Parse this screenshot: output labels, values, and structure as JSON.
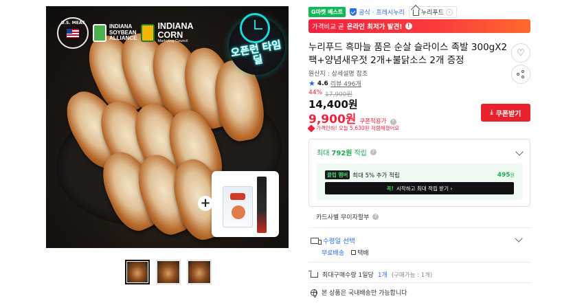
{
  "gallery": {
    "logos": {
      "usmef_seal": "U.S. MEAT",
      "soybean_line1": "INDIANA",
      "soybean_line2": "SOYBEAN",
      "soybean_line3": "ALLIANCE",
      "corn_line1": "INDIANA",
      "corn_line2": "CORN",
      "corn_sub": "Marketing Council"
    },
    "timedeal_badge": "오픈런 타임딜",
    "thumbnails": [
      {
        "name": "thumbnail-1",
        "active": true
      },
      {
        "name": "thumbnail-2",
        "active": false
      },
      {
        "name": "thumbnail-3",
        "active": false
      }
    ]
  },
  "tags": {
    "best": "G마켓 베스트",
    "official_label": "공식",
    "official_tier": "· 프레시누리",
    "store_name": "누리푸드"
  },
  "banner": {
    "prefix": "가격비교 곧",
    "bold": "온라인 최저가 발견!",
    "info_icon": "!"
  },
  "product": {
    "title": "누리푸드 흑마늘 품은 순살 슬라이스 족발 300gX2팩+양념새우젓 2개+불닭소스 2개 증정",
    "origin": "원산지 : 상세설명 참조",
    "rating_score": "4.6",
    "review_label": "리뷰 496개",
    "discount_pct": "44%",
    "original_price": "17,900원",
    "price": "14,400원",
    "coupon_price": "9,900원",
    "coupon_price_label": "쿠폰적용가",
    "price_notice": "가격인하! 오늘 5,630원 저렴해졌어요"
  },
  "actions": {
    "coupon_button": "쿠폰받기"
  },
  "points": {
    "head_prefix": "최대",
    "head_amount": "792원",
    "head_suffix": "적립",
    "club_badge": "클럽",
    "club_badge_rest": "멤버",
    "club_text": "최대 5% 추가 적립",
    "club_amount": "495",
    "club_unit": "원",
    "club_button_g": "꼭!",
    "club_button": "시작하고 최대 적립 받기 ›"
  },
  "card_benefit": {
    "label": "카드사별 무이자할부",
    "info_icon": "?"
  },
  "shipping": {
    "title": "수령일 선택",
    "option_free": "무료배송",
    "option_parcel": "택배"
  },
  "limit": {
    "prefix": "최대구매수량 1일당",
    "count": "1개",
    "sub": "(구매가능 : 1개)"
  },
  "domestic": {
    "text": "본 상품은 국내배송만 가능합니다"
  },
  "colors": {
    "accent_red": "#f0233f",
    "accent_blue": "#2f6de8",
    "accent_green": "#1faa55"
  }
}
